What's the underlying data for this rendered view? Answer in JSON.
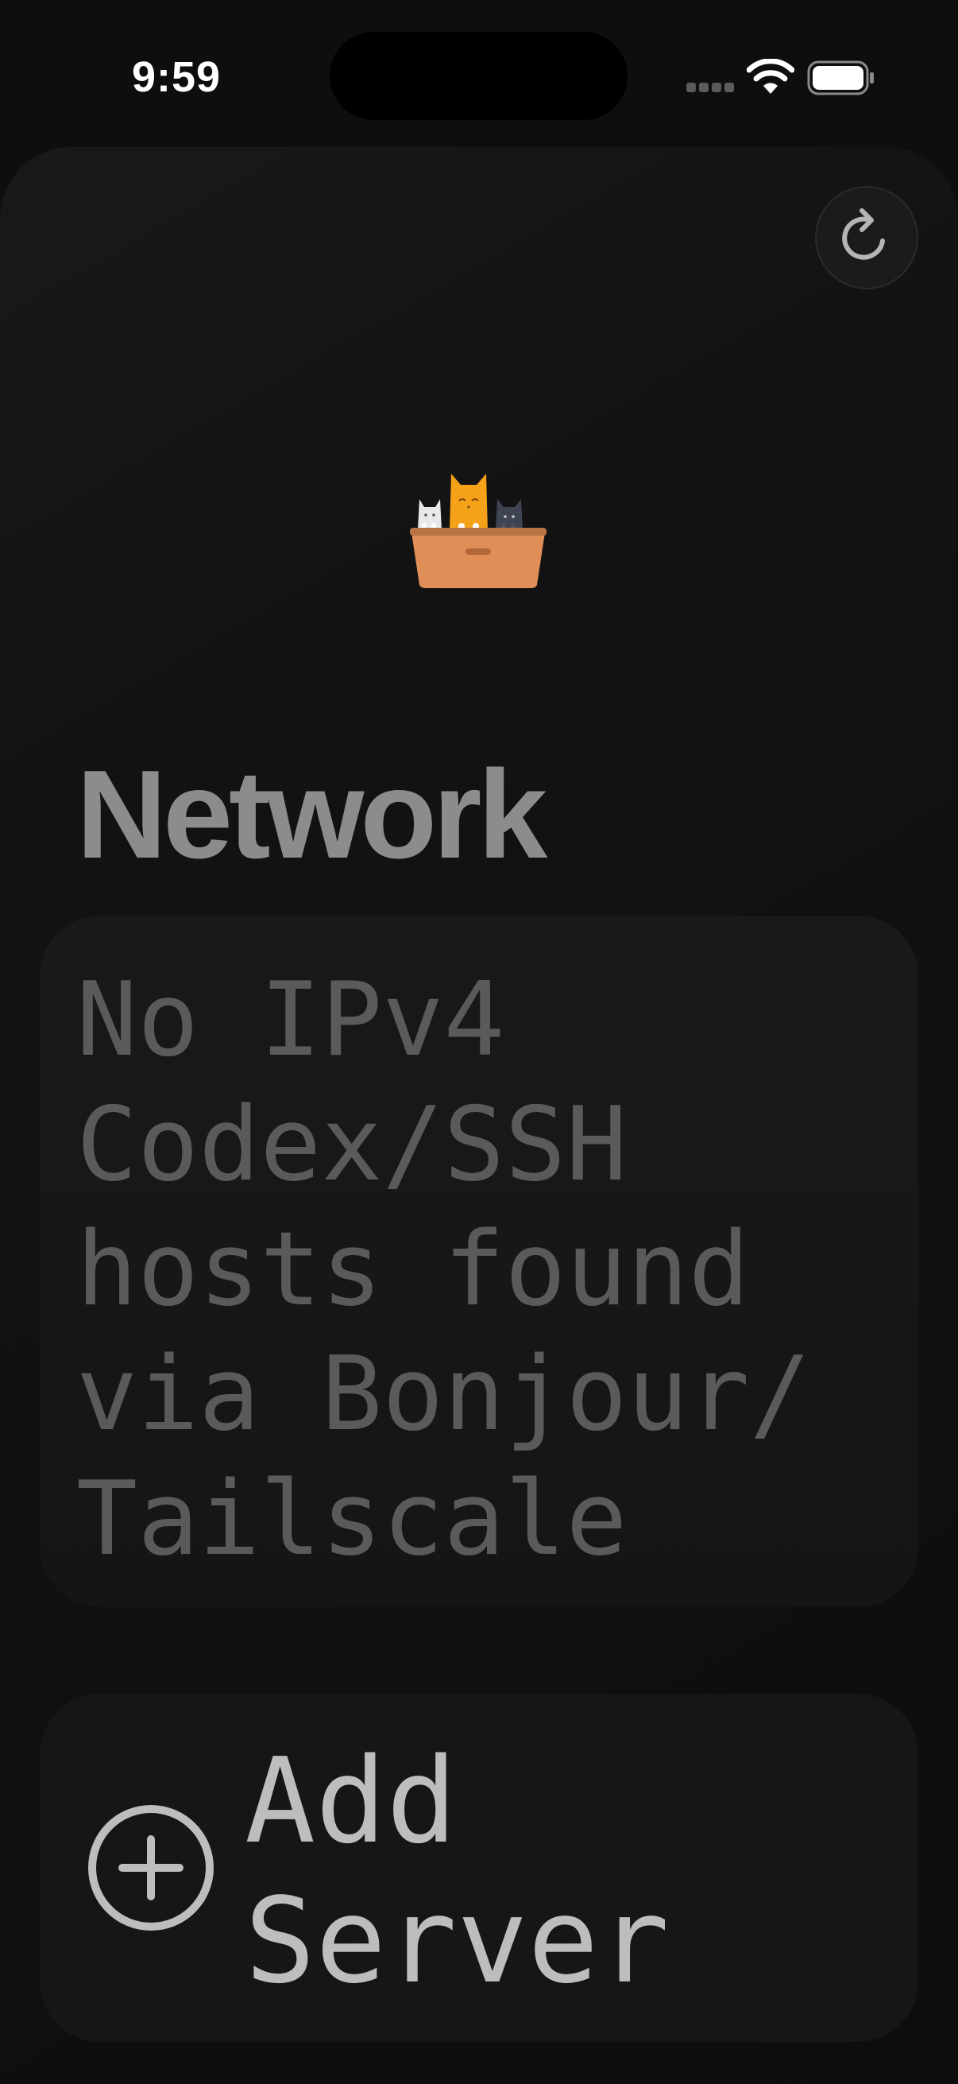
{
  "status_bar": {
    "time": "9:59",
    "battery_icon": "battery-full-icon",
    "wifi_icon": "wifi-icon",
    "signal_icon": "cellular-signal-icon"
  },
  "toolbar": {
    "refresh_icon": "refresh-icon"
  },
  "header": {
    "logo": "cats-in-box-logo",
    "title": "Network"
  },
  "empty_state": {
    "message": "No IPv4 Codex/SSH hosts found via Bonjour/ Tailscale"
  },
  "actions": {
    "add_server_icon": "plus-circle-icon",
    "add_server_label": "Add Server"
  },
  "colors": {
    "background": "#0e0e0e",
    "title": "#8c8c8c",
    "muted_text": "#5a5a5a",
    "action_text": "#bdbdbd",
    "card": "#161616"
  }
}
